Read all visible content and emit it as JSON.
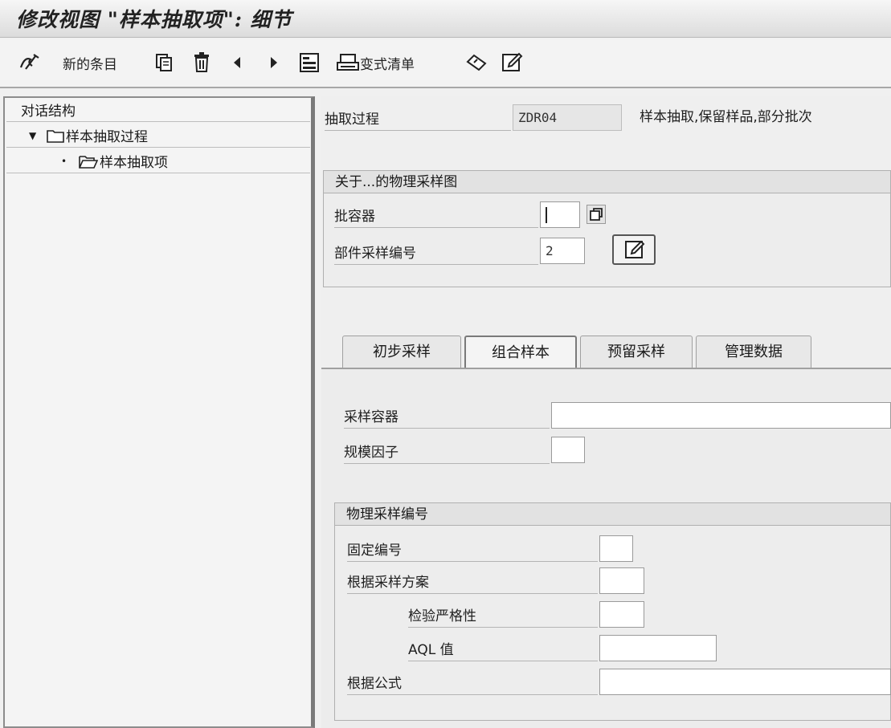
{
  "window": {
    "title": "修改视图 \"样本抽取项\": 细节"
  },
  "toolbar": {
    "new_entries_label": "新的条目",
    "variant_list_label": "变式清单",
    "icons": [
      "display-change-icon",
      "copy-icon",
      "delete-icon",
      "previous-icon",
      "next-icon",
      "select-block-icon",
      "variant-list-icon",
      "undo-icon",
      "edit-icon"
    ]
  },
  "tree": {
    "header": "对话结构",
    "items": [
      {
        "label": "样本抽取过程",
        "marker": "▼",
        "icon": "folder-closed-icon"
      },
      {
        "label": "样本抽取项",
        "marker": "•",
        "icon": "folder-open-icon"
      }
    ]
  },
  "procedure": {
    "label": "抽取过程",
    "value": "ZDR04",
    "description": "样本抽取,保留样品,部分批次"
  },
  "physical_sample_drawing": {
    "title": "关于...的物理采样图",
    "container_label": "批容器",
    "container_value": "",
    "part_sample_no_label": "部件采样编号",
    "part_sample_no_value": "2"
  },
  "tabs": [
    {
      "label": "初步采样",
      "active": false
    },
    {
      "label": "组合样本",
      "active": true
    },
    {
      "label": "预留采样",
      "active": false
    },
    {
      "label": "管理数据",
      "active": false
    }
  ],
  "pooled_sample": {
    "container_label": "采样容器",
    "container_value": "",
    "scale_factor_label": "规模因子",
    "scale_factor_value": ""
  },
  "physical_sample_number": {
    "title": "物理采样编号",
    "fixed_number_label": "固定编号",
    "by_sampling_plan_label": "根据采样方案",
    "inspection_severity_label": "检验严格性",
    "aql_label": "AQL 值",
    "by_formula_label": "根据公式"
  }
}
